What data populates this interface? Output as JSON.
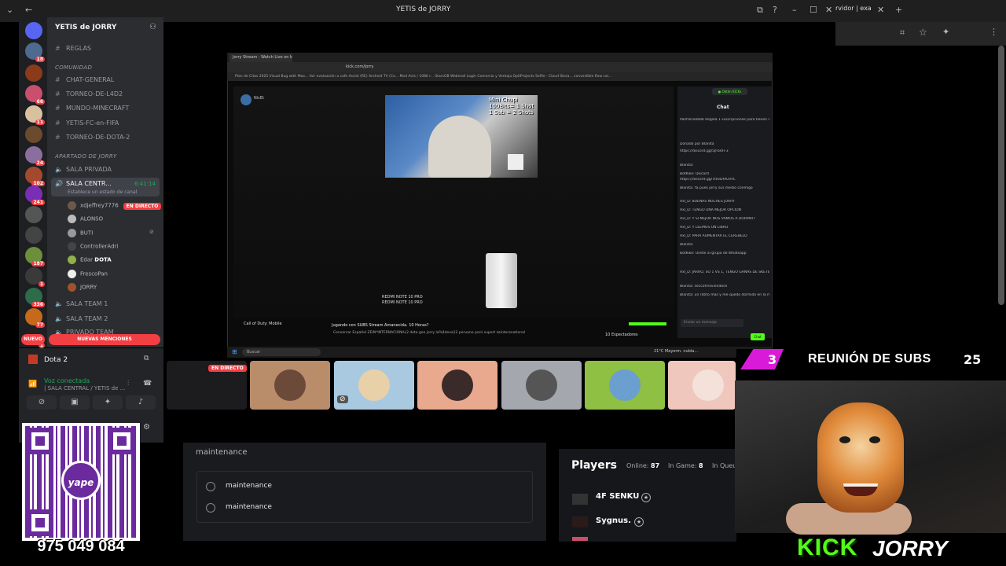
{
  "window": {
    "title": "YETIS de JORRY",
    "right_tab": "rvidor | exa"
  },
  "discord": {
    "server_name": "YETIS de JORRY",
    "server_badges": [
      "18",
      "",
      "66",
      "11",
      "",
      "24",
      "102",
      "241",
      "",
      "",
      "187",
      "1",
      "336",
      "77",
      "1"
    ],
    "channels": [
      {
        "name": "REGLAS"
      },
      {
        "category": "COMUNIDAD"
      },
      {
        "name": "CHAT-GENERAL"
      },
      {
        "name": "TORNEO-DE-L4D2"
      },
      {
        "name": "MUNDO-MINECRAFT"
      },
      {
        "name": "YETIS-FC-en-FIFA"
      },
      {
        "name": "TORNEO-DE-DOTA-2"
      },
      {
        "category": "APARTADO DE JORRY"
      },
      {
        "name": "SALA PRIVADA"
      },
      {
        "name": "SALA CENTR...",
        "time": "6:41:14",
        "status": "Establece un estado de canal"
      }
    ],
    "voice_users": [
      {
        "name": "xdjeffrey7776",
        "live": "EN DIRECTO"
      },
      {
        "name": "ALONSO"
      },
      {
        "name": "BUTI"
      },
      {
        "name": "ControllerAdri"
      },
      {
        "name": "Edar",
        "activity": "DOTA"
      },
      {
        "name": "FrescoPan"
      },
      {
        "name": "JORRY"
      }
    ],
    "extra_channels": [
      "SALA TEAM 1",
      "SALA TEAM 2",
      "PRIVADO TEAM"
    ],
    "new_mentions": "NUEVAS MENCIONES",
    "nuevo": "NUEVO",
    "activity_name": "Dota 2",
    "voice_connected": "Voz conectada",
    "voice_location": "| SALA CENTRAL / YETIS de ..."
  },
  "qr": {
    "brand": "yape",
    "phone": "975 049 084"
  },
  "inner_screen": {
    "tab_title": "Jorry Stream - Watch Live on ki...",
    "url": "kick.com/jorry",
    "bookmarks": "Plan de Citas 2025   Visual Bug with Max...   fair evaluación   a cafe Assist   (RE) Android TV (Co...   Mod Acts / 1080 r...   StarsGB   Webmail Login   Comercio y Ventaja   OptiProjects   Selfie - Cloud Stora...   convertible flow cal...",
    "streamer": "NicEt",
    "overlay_text": [
      "Mini Chupi",
      "100Bits= 1 Shot",
      "1 Sub = 2 Shots"
    ],
    "device_label": [
      "REDMI NOTE 10 PRO",
      "REDMI NOTE 10 PRO"
    ],
    "chat_title": "Chat",
    "chat_lines": [
      "Panfrecoo666  Regala 1 suscripciones para tienen su posición 2",
      "Donado por Blanita",
      "https://discord.gg/5JFb4FF3",
      "Blanita:",
      "BotKike: Discord",
      "https://discord.gg/TtevDfAUrHC",
      "Blanita: Ya pues jorry sus medio conmigo",
      "Axl_D: BUENAS NOCHES JORRY",
      "Axl_D: TENGO UNA MEJOR OPCION",
      "Axl_D: Y SI MEJOR NOS VAMOS A DORMIR?",
      "Axl_D: Y LEEMOS UN LIBRO",
      "Axl_D: PARA AUMENTAR EL CEREBELO",
      "Blanita:",
      "BotKike: Unete al grupo de Whatsapp",
      "Axl_D: JARRO, SO 1 VS 1, TENGO GANAS DE SKETEARTE",
      "Blanita: seccofresviendoce",
      "Blanita: un ratito mas y me quedo dormido en la mesa addcinto"
    ],
    "chat_input": "Enviar un mensaje",
    "chat_button": "Chat",
    "stream_title": "Jugando con SUBS  Stream Amanecida. 10 Horas?",
    "tags": "Conversar  Español  ZEIN*INTERNACIONAL2  dota  geo  jorry  la%4deva12  peruano  perú  suport  zainteranational",
    "viewers": "10 Espectadores",
    "game": "Call of Duty: Mobile",
    "taskbar_search": "Buscar",
    "taskbar_weather": "21°C  Mayorm. nubla..."
  },
  "tiles": {
    "live_badge": "EN DIRECTO"
  },
  "page": {
    "maintenance_title": "maintenance",
    "options": [
      "maintenance",
      "maintenance"
    ],
    "players_title": "Players",
    "online_label": "Online:",
    "online": "87",
    "ingame_label": "In Game:",
    "ingame": "8",
    "inqueue_label": "In Queu",
    "players": [
      {
        "name": "4F SENKU"
      },
      {
        "name": "Sygnus."
      }
    ]
  },
  "overlay": {
    "subs_left": "3",
    "subs_title": "REUNIÓN DE SUBS",
    "subs_right": "25",
    "kick_logo": "KICK",
    "kick_name": "JORRY"
  },
  "colors": {
    "kick_green": "#53fc18",
    "discord_red": "#f23f43",
    "yape_purple": "#6b2b9e",
    "subs_pink": "#d91bd9"
  }
}
